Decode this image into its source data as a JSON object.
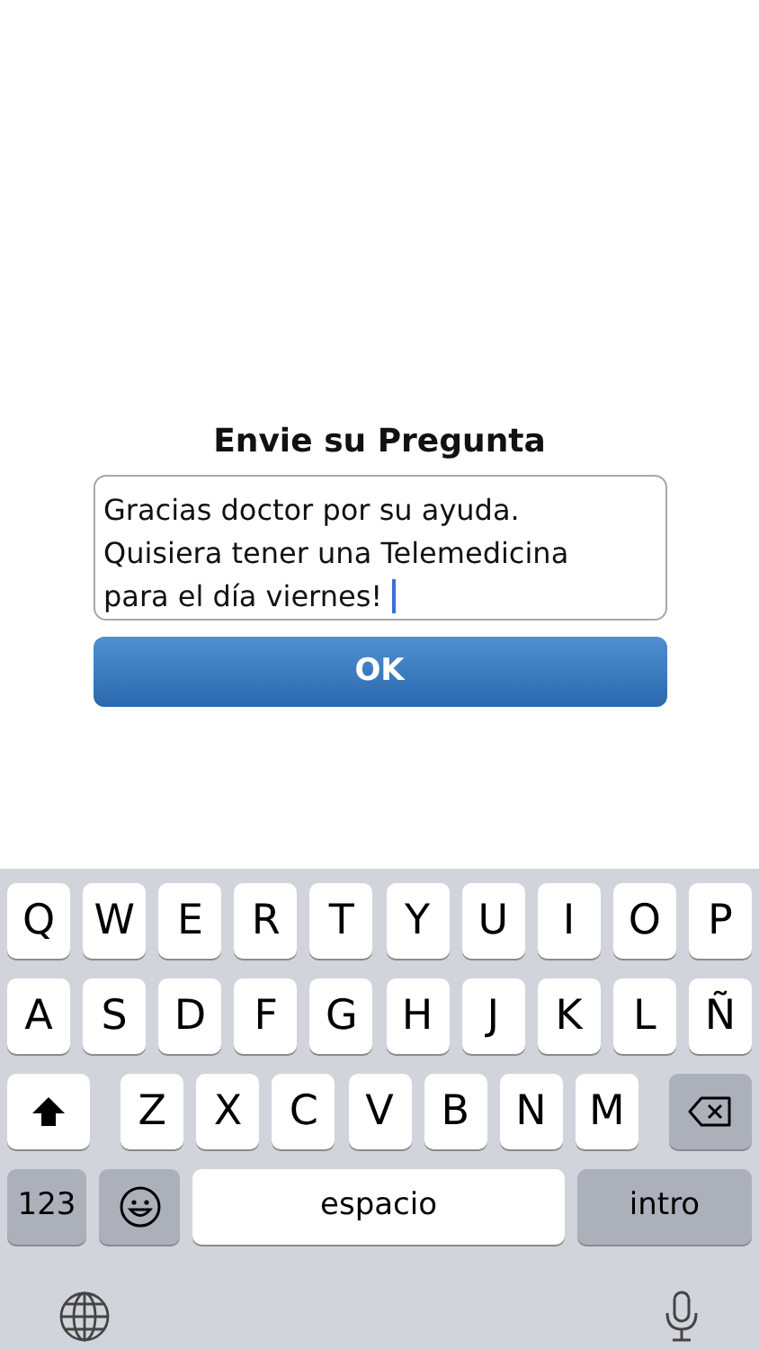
{
  "form": {
    "title": "Envie su Pregunta",
    "question": {
      "value": "Gracias doctor por su ayuda.\nQuisiera tener una Telemedicina\npara el día viernes!",
      "focused": true
    },
    "submit_button": "OK"
  },
  "keyboard": {
    "rows": [
      [
        {
          "kind": "letter",
          "label": "Q"
        },
        {
          "kind": "letter",
          "label": "W"
        },
        {
          "kind": "letter",
          "label": "E"
        },
        {
          "kind": "letter",
          "label": "R"
        },
        {
          "kind": "letter",
          "label": "T"
        },
        {
          "kind": "letter",
          "label": "Y"
        },
        {
          "kind": "letter",
          "label": "U"
        },
        {
          "kind": "letter",
          "label": "I"
        },
        {
          "kind": "letter",
          "label": "O"
        },
        {
          "kind": "letter",
          "label": "P"
        }
      ],
      [
        {
          "kind": "letter",
          "label": "A"
        },
        {
          "kind": "letter",
          "label": "S"
        },
        {
          "kind": "letter",
          "label": "D"
        },
        {
          "kind": "letter",
          "label": "F"
        },
        {
          "kind": "letter",
          "label": "G"
        },
        {
          "kind": "letter",
          "label": "H"
        },
        {
          "kind": "letter",
          "label": "J"
        },
        {
          "kind": "letter",
          "label": "K"
        },
        {
          "kind": "letter",
          "label": "L"
        },
        {
          "kind": "letter",
          "label": "Ñ"
        }
      ],
      [
        {
          "kind": "shift"
        },
        {
          "kind": "letter",
          "label": "Z"
        },
        {
          "kind": "letter",
          "label": "X"
        },
        {
          "kind": "letter",
          "label": "C"
        },
        {
          "kind": "letter",
          "label": "V"
        },
        {
          "kind": "letter",
          "label": "B"
        },
        {
          "kind": "letter",
          "label": "N"
        },
        {
          "kind": "letter",
          "label": "M"
        },
        {
          "kind": "delete"
        }
      ]
    ],
    "bottom_bar": {
      "numbers_key": "123",
      "space_key": "espacio",
      "return_key": "intro"
    }
  }
}
